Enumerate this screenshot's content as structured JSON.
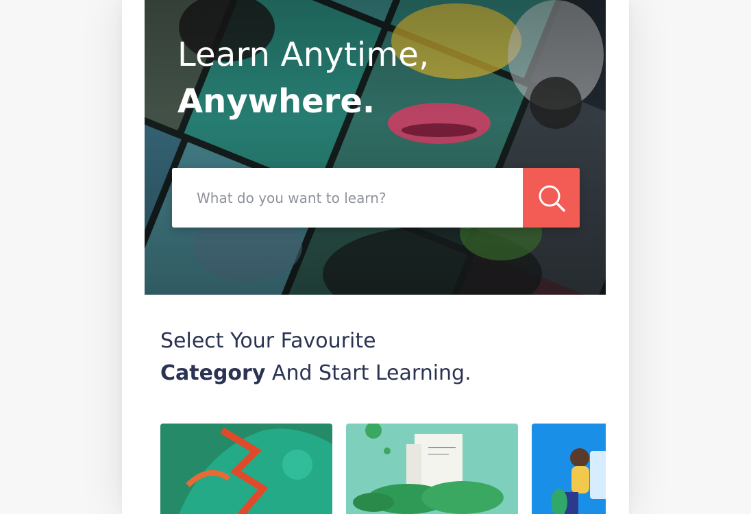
{
  "hero": {
    "title_line1": "Learn Anytime,",
    "title_line2": "Anywhere."
  },
  "search": {
    "placeholder": "What do you want to learn?",
    "button_icon": "search-icon"
  },
  "section": {
    "title_line1": "Select Your Favourite",
    "title_bold": "Category",
    "title_rest": " And Start Learning."
  },
  "colors": {
    "accent": "#f25c54",
    "heading": "#2b3353"
  }
}
